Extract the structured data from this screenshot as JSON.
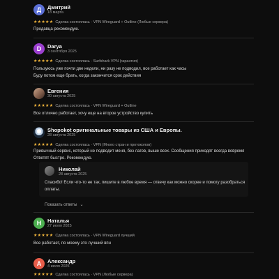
{
  "reviews": [
    {
      "avatar_letter": "Д",
      "avatar_color": "#5b6fd6",
      "name": "Дмитрий",
      "date": "18 марта",
      "stars": "★★★★★",
      "meta": "Сделка состоялась · VPN Wireguard + Outline (Любые сервера)",
      "text_lines": [
        "Продавца рекомендую."
      ]
    },
    {
      "avatar_letter": "D",
      "avatar_color": "#9c3fd0",
      "name": "Darya",
      "date": "3 сентября 2025",
      "stars": "★★★★★",
      "meta": "Сделка состоялась · Surfshark VPN (гарантия)",
      "text_lines": [
        "Пользуюсь уже почти две недели, ни разу не подводил, все работает как часы",
        "Буду потом еще брать, когда закончится срок действия"
      ]
    },
    {
      "name": "Евгения",
      "date": "30 августа 2025",
      "stars": "★★★★★",
      "meta": "Сделка состоялась · VPN Wireguard + Outline",
      "text_lines": [
        "Все отлично работает, хочу еще на второе устройство купить"
      ]
    },
    {
      "name": "Shopokot оригинальные товары из США и Европы.",
      "date": "28 августа 2025",
      "stars": "★★★★★",
      "meta": "Сделка состоялась · VPN (Много стран и протоколов)",
      "text_lines": [
        "Привычный сервис, который не подводит меня, без лагов, выше всех. Сообщения приходят всегда вовремя",
        "Ответят быстро. Рекомендую."
      ]
    },
    {
      "avatar_letter": "Н",
      "avatar_color": "#4caf50",
      "name": "Наталья",
      "date": "27 июля 2025",
      "stars": "★★★★★",
      "meta": "Сделка состоялась · VPN Wireguard лучший",
      "text_lines": [
        "Все работает, по моему это лучший впн"
      ]
    },
    {
      "avatar_letter": "А",
      "avatar_color": "#e85d4a",
      "name": "Александр",
      "date": "4 июля 2025",
      "stars": "★★★★★",
      "meta": "Сделка состоялась · VPN (Любые сервера)",
      "text_lines": []
    }
  ],
  "reply": {
    "name": "Николай",
    "date": "28 августа 2025",
    "text_lines": [
      "Спасибо! Если что-то не так, пишите в любое время — отвечу как можно скорее и помогу разобраться",
      "оплаты."
    ]
  },
  "show_more_label": "Показать ответы",
  "chevron_glyph": "⌄"
}
